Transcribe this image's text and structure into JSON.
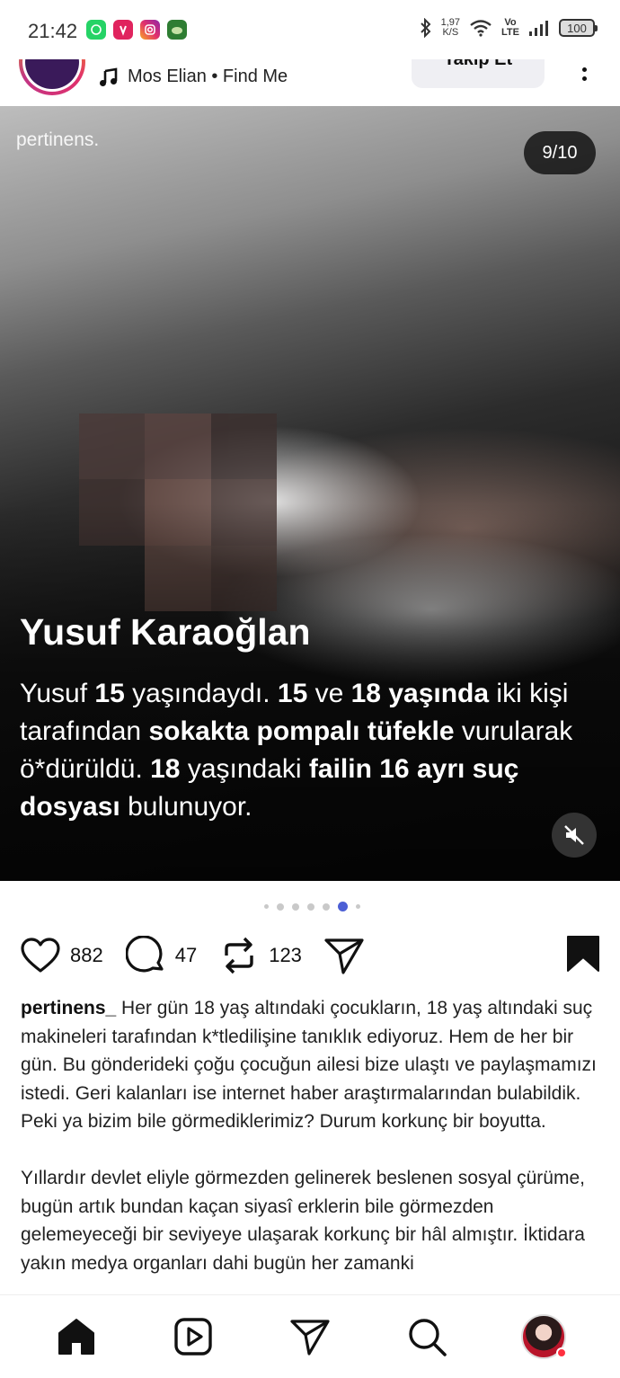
{
  "status_bar": {
    "time": "21:42",
    "apps": [
      "whatsapp-icon",
      "app-pink-icon",
      "instagram-icon",
      "game-icon"
    ],
    "net_speed_value": "1,97",
    "net_speed_unit": "K/S",
    "volte_top": "Vo",
    "volte_bottom": "LTE",
    "battery": "100"
  },
  "post_header": {
    "music": "Mos Elian • Find Me",
    "follow_label": "Takip Et"
  },
  "media": {
    "watermark": "pertinens.",
    "counter": "9/10",
    "title": "Yusuf Karaoğlan",
    "text_parts": [
      {
        "t": "Yusuf ",
        "b": false
      },
      {
        "t": "15",
        "b": true
      },
      {
        "t": " yaşındaydı. ",
        "b": false
      },
      {
        "t": "15",
        "b": true
      },
      {
        "t": " ve ",
        "b": false
      },
      {
        "t": "18 yaşında",
        "b": true
      },
      {
        "t": " iki kişi tarafından ",
        "b": false
      },
      {
        "t": "sokakta pompalı tüfekle",
        "b": true
      },
      {
        "t": " vurularak ö*dürüldü. ",
        "b": false
      },
      {
        "t": "18",
        "b": true
      },
      {
        "t": " yaşındaki ",
        "b": false
      },
      {
        "t": "failin 16 ayrı suç dosyası",
        "b": true
      },
      {
        "t": " bulunuyor.",
        "b": false
      }
    ]
  },
  "carousel": {
    "total": 7,
    "active": 5
  },
  "actions": {
    "likes": "882",
    "comments": "47",
    "reposts": "123"
  },
  "caption": {
    "username": "pertinens_",
    "paragraph1": " Her gün 18 yaş altındaki çocukların, 18 yaş altındaki suç makineleri tarafından k*tledilişine tanıklık ediyoruz. Hem de her bir gün. Bu gönderideki çoğu çocuğun ailesi bize ulaştı ve paylaşmamızı istedi. Geri kalanları ise internet haber araştırmalarından bulabildik. Peki ya bizim bile görmediklerimiz? Durum korkunç bir boyutta.",
    "paragraph2": "Yıllardır devlet eliyle görmezden gelinerek beslenen sosyal çürüme, bugün artık bundan kaçan siyasî erklerin bile görmezden gelemeyeceği bir seviyeye ulaşarak korkunç bir hâl almıştır. İktidara yakın medya organları dahi bugün her zamanki"
  },
  "colors": {
    "carousel_active": "#4c5fd5",
    "notification": "#ff3040"
  }
}
